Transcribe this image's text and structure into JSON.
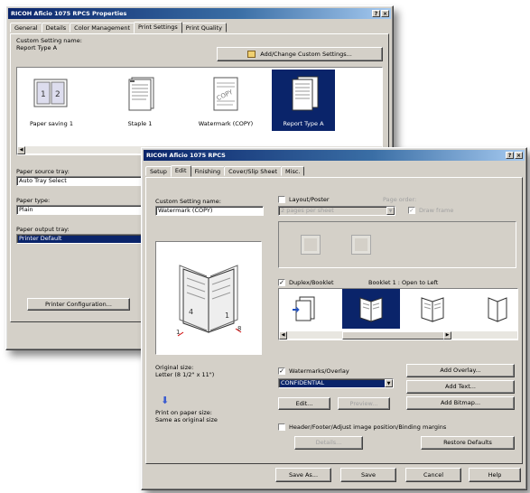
{
  "back_window": {
    "title": "RICOH Aficio 1075 RPCS Properties",
    "tabs": [
      "General",
      "Details",
      "Color Management",
      "Print Settings",
      "Print Quality"
    ],
    "active_tab": "Print Settings",
    "custom_setting_label": "Custom Setting name:",
    "custom_setting_value": "Report Type A",
    "add_change_button": "Add/Change Custom Settings...",
    "icons": [
      {
        "label": "Paper saving 1",
        "icon": "two-up-pages-icon"
      },
      {
        "label": "Staple 1",
        "icon": "stapled-pages-icon"
      },
      {
        "label": "Watermark (COPY)",
        "icon": "watermark-copy-icon"
      },
      {
        "label": "Report Type A",
        "icon": "report-pages-icon"
      }
    ],
    "paper_source_label": "Paper source tray:",
    "paper_source_value": "Auto Tray Select",
    "paper_type_label": "Paper type:",
    "paper_type_value": "Plain",
    "paper_output_label": "Paper output tray:",
    "paper_output_value": "Printer Default",
    "printer_config_button": "Printer Configuration..."
  },
  "front_window": {
    "title": "RICOH Aficio 1075 RPCS",
    "tabs": [
      "Setup",
      "Edit",
      "Finishing",
      "Cover/Slip Sheet",
      "Misc."
    ],
    "active_tab": "Edit",
    "custom_setting_label": "Custom Setting name:",
    "custom_setting_value": "Watermark (COPY)",
    "preview_icon": "booklet-preview-icon",
    "original_size_label": "Original size:",
    "original_size_value": "Letter (8 1/2\" x 11\")",
    "print_size_label": "Print on paper size:",
    "print_size_value": "Same as original size",
    "layout_poster_label": "Layout/Poster",
    "layout_checked": false,
    "pages_per_sheet_value": "2 pages per sheet",
    "page_order_label": "Page order:",
    "draw_frame_label": "Draw frame",
    "duplex_booklet_label": "Duplex/Booklet",
    "duplex_checked": true,
    "booklet_info": "Booklet 1 : Open to Left",
    "booklet_options": [
      {
        "icon": "duplex-icon"
      },
      {
        "icon": "booklet-open-left-icon"
      },
      {
        "icon": "booklet-open-right-icon"
      },
      {
        "icon": "booklet-variant-icon"
      }
    ],
    "watermark_label": "Watermarks/Overlay",
    "watermark_checked": true,
    "watermark_value": "CONFIDENTIAL",
    "edit_button": "Edit...",
    "preview_button": "Preview...",
    "add_overlay_button": "Add Overlay...",
    "add_text_button": "Add Text...",
    "add_bitmap_button": "Add Bitmap...",
    "header_footer_label": "Header/Footer/Adjust image position/Binding margins",
    "header_checked": false,
    "details_button": "Details...",
    "restore_defaults_button": "Restore Defaults",
    "footer_buttons": [
      "Save As...",
      "Save",
      "Cancel",
      "Help"
    ]
  }
}
